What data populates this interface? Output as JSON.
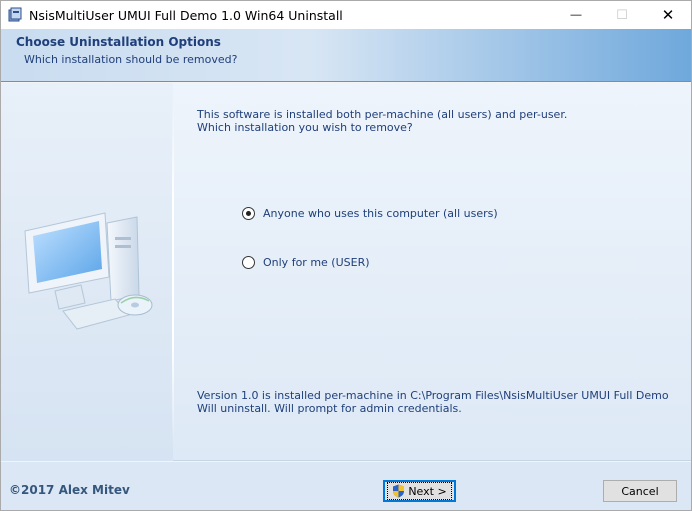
{
  "window": {
    "title": "NsisMultiUser UMUI Full Demo 1.0 Win64 Uninstall",
    "minimize_glyph": "—",
    "maximize_glyph": "☐",
    "close_glyph": "✕"
  },
  "header": {
    "title": "Choose Uninstallation Options",
    "subtitle": "Which installation should be removed?"
  },
  "content": {
    "intro_line1": "This software is installed both per-machine (all users) and per-user.",
    "intro_line2": "Which installation you wish to remove?",
    "options": [
      {
        "label": "Anyone who uses this computer (all users)",
        "selected": true
      },
      {
        "label": "Only for me (USER)",
        "selected": false
      }
    ],
    "status_line1": "Version 1.0 is installed per-machine in C:\\Program Files\\NsisMultiUser UMUI Full Demo",
    "status_line2": "Will uninstall. Will prompt for admin credentials."
  },
  "footer": {
    "brand": "©2017 Alex Mitev",
    "next_label": "Next >",
    "cancel_label": "Cancel"
  },
  "colors": {
    "text_blue": "#1f3f7a",
    "focus_blue": "#0078d7"
  }
}
